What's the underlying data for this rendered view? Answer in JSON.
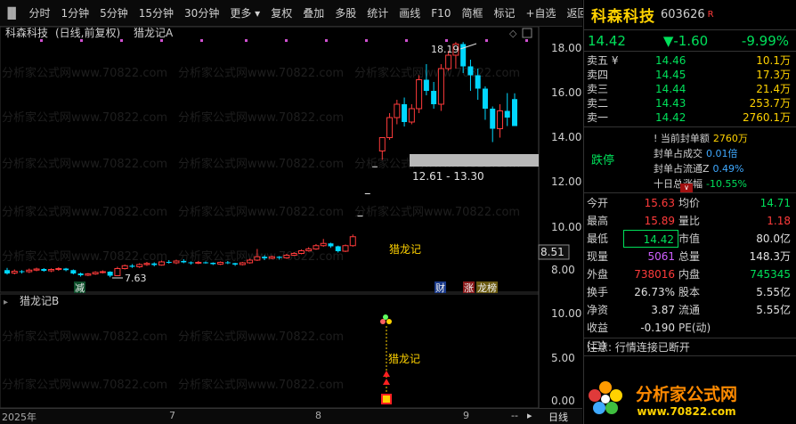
{
  "toolbar": {
    "items": [
      "分时",
      "1分钟",
      "5分钟",
      "15分钟",
      "30分钟",
      "更多",
      "复权",
      "叠加",
      "多股",
      "统计",
      "画线",
      "F10",
      "简框",
      "标记",
      "+自选",
      "返回"
    ]
  },
  "chart": {
    "title_stock": "科森科技",
    "title_mode": "(日线,前复权)",
    "indicator_a": "猎龙记A",
    "indicator_b": "猎龙记B",
    "high_label": "18.19",
    "low_label": "7.63",
    "range_label": "12.61 - 13.30",
    "signal_label": "猎龙记",
    "signal_label_b": "猎龙记",
    "current_price_tag": "8.51",
    "price_axis": [
      "18.00",
      "16.00",
      "14.00",
      "12.00",
      "10.00",
      "8.00"
    ],
    "indicator_axis": [
      "10.00",
      "5.00",
      "0.00"
    ],
    "markers": {
      "jian": "减",
      "cai": "财",
      "zhang": "涨",
      "long": "龙榜"
    },
    "watermark": "分析家公式网www.70822.com",
    "x_labels": [
      "2025年",
      "7",
      "8",
      "9"
    ],
    "period": "日线",
    "scroll_btn": "--"
  },
  "chart_data": {
    "type": "candlestick",
    "title": "科森科技 (日线,前复权)",
    "ylim": [
      6.5,
      19.3
    ],
    "candles": [
      {
        "o": 7.95,
        "c": 7.8,
        "h": 8.05,
        "l": 7.75
      },
      {
        "o": 7.82,
        "c": 7.9,
        "h": 7.98,
        "l": 7.76
      },
      {
        "o": 7.9,
        "c": 7.88,
        "h": 7.95,
        "l": 7.8
      },
      {
        "o": 7.88,
        "c": 7.95,
        "h": 8.02,
        "l": 7.82
      },
      {
        "o": 7.95,
        "c": 8.0,
        "h": 8.06,
        "l": 7.9
      },
      {
        "o": 8.0,
        "c": 7.92,
        "h": 8.04,
        "l": 7.88
      },
      {
        "o": 7.92,
        "c": 7.98,
        "h": 8.03,
        "l": 7.86
      },
      {
        "o": 7.98,
        "c": 8.02,
        "h": 8.08,
        "l": 7.92
      },
      {
        "o": 8.02,
        "c": 7.95,
        "h": 8.05,
        "l": 7.9
      },
      {
        "o": 7.95,
        "c": 7.8,
        "h": 7.98,
        "l": 7.76
      },
      {
        "o": 7.8,
        "c": 7.72,
        "h": 7.84,
        "l": 7.66
      },
      {
        "o": 7.72,
        "c": 7.78,
        "h": 7.82,
        "l": 7.68
      },
      {
        "o": 7.78,
        "c": 7.85,
        "h": 7.9,
        "l": 7.74
      },
      {
        "o": 7.85,
        "c": 7.88,
        "h": 7.94,
        "l": 7.8
      },
      {
        "o": 7.88,
        "c": 7.7,
        "h": 7.9,
        "l": 7.63
      },
      {
        "o": 7.7,
        "c": 8.02,
        "h": 8.1,
        "l": 7.68
      },
      {
        "o": 8.02,
        "c": 8.15,
        "h": 8.2,
        "l": 7.98
      },
      {
        "o": 8.15,
        "c": 8.1,
        "h": 8.22,
        "l": 8.05
      },
      {
        "o": 8.1,
        "c": 8.2,
        "h": 8.26,
        "l": 8.05
      },
      {
        "o": 8.2,
        "c": 8.25,
        "h": 8.32,
        "l": 8.14
      },
      {
        "o": 8.25,
        "c": 8.18,
        "h": 8.3,
        "l": 8.12
      },
      {
        "o": 8.18,
        "c": 8.32,
        "h": 8.38,
        "l": 8.15
      },
      {
        "o": 8.32,
        "c": 8.28,
        "h": 8.4,
        "l": 8.24
      },
      {
        "o": 8.28,
        "c": 8.36,
        "h": 8.42,
        "l": 8.22
      },
      {
        "o": 8.36,
        "c": 8.3,
        "h": 8.44,
        "l": 8.26
      },
      {
        "o": 8.3,
        "c": 8.26,
        "h": 8.34,
        "l": 8.2
      },
      {
        "o": 8.26,
        "c": 8.3,
        "h": 8.36,
        "l": 8.22
      },
      {
        "o": 8.3,
        "c": 8.28,
        "h": 8.34,
        "l": 8.24
      },
      {
        "o": 8.28,
        "c": 8.22,
        "h": 8.3,
        "l": 8.18
      },
      {
        "o": 8.22,
        "c": 8.3,
        "h": 8.34,
        "l": 8.18
      },
      {
        "o": 8.3,
        "c": 8.26,
        "h": 8.36,
        "l": 8.22
      },
      {
        "o": 8.26,
        "c": 8.2,
        "h": 8.28,
        "l": 8.14
      },
      {
        "o": 8.2,
        "c": 8.28,
        "h": 8.32,
        "l": 8.16
      },
      {
        "o": 8.28,
        "c": 8.4,
        "h": 8.46,
        "l": 8.24
      },
      {
        "o": 8.4,
        "c": 8.55,
        "h": 8.9,
        "l": 8.36
      },
      {
        "o": 8.55,
        "c": 8.48,
        "h": 8.62,
        "l": 8.4
      },
      {
        "o": 8.48,
        "c": 8.55,
        "h": 8.6,
        "l": 8.44
      },
      {
        "o": 8.55,
        "c": 8.5,
        "h": 8.58,
        "l": 8.42
      },
      {
        "o": 8.5,
        "c": 8.62,
        "h": 8.68,
        "l": 8.46
      },
      {
        "o": 8.62,
        "c": 8.7,
        "h": 8.76,
        "l": 8.58
      },
      {
        "o": 8.7,
        "c": 8.82,
        "h": 8.88,
        "l": 8.66
      },
      {
        "o": 8.82,
        "c": 8.9,
        "h": 8.98,
        "l": 8.78
      },
      {
        "o": 8.9,
        "c": 9.05,
        "h": 9.12,
        "l": 8.86
      },
      {
        "o": 9.05,
        "c": 9.15,
        "h": 9.35,
        "l": 9.0
      },
      {
        "o": 9.15,
        "c": 9.02,
        "h": 9.18,
        "l": 8.95
      },
      {
        "o": 9.02,
        "c": 8.8,
        "h": 9.05,
        "l": 8.74
      },
      {
        "o": 8.8,
        "c": 9.05,
        "h": 9.1,
        "l": 8.76
      },
      {
        "o": 9.05,
        "c": 9.45,
        "h": 9.55,
        "l": 9.0
      },
      {
        "o": 10.4,
        "c": 10.4,
        "h": 10.4,
        "l": 10.4
      },
      {
        "o": 11.4,
        "c": 11.4,
        "h": 11.4,
        "l": 11.4
      },
      {
        "o": 12.61,
        "c": 12.61,
        "h": 12.61,
        "l": 12.61
      },
      {
        "o": 13.3,
        "c": 13.9,
        "h": 13.9,
        "l": 12.9
      },
      {
        "o": 13.9,
        "c": 14.8,
        "h": 15.0,
        "l": 13.8
      },
      {
        "o": 14.8,
        "c": 15.4,
        "h": 15.6,
        "l": 14.5
      },
      {
        "o": 15.4,
        "c": 14.6,
        "h": 15.7,
        "l": 14.4
      },
      {
        "o": 14.6,
        "c": 15.2,
        "h": 15.4,
        "l": 14.5
      },
      {
        "o": 15.2,
        "c": 16.5,
        "h": 16.7,
        "l": 15.0
      },
      {
        "o": 16.5,
        "c": 16.0,
        "h": 17.2,
        "l": 15.8
      },
      {
        "o": 16.0,
        "c": 15.4,
        "h": 16.4,
        "l": 15.2
      },
      {
        "o": 15.4,
        "c": 17.0,
        "h": 17.2,
        "l": 15.1
      },
      {
        "o": 17.0,
        "c": 17.6,
        "h": 17.8,
        "l": 16.9
      },
      {
        "o": 17.6,
        "c": 18.1,
        "h": 18.19,
        "l": 17.0
      },
      {
        "o": 18.1,
        "c": 17.1,
        "h": 18.19,
        "l": 16.8
      },
      {
        "o": 17.1,
        "c": 16.7,
        "h": 17.4,
        "l": 16.0
      },
      {
        "o": 16.7,
        "c": 16.1,
        "h": 17.0,
        "l": 15.6
      },
      {
        "o": 16.1,
        "c": 15.2,
        "h": 16.2,
        "l": 14.7
      },
      {
        "o": 15.2,
        "c": 14.3,
        "h": 15.3,
        "l": 13.7
      },
      {
        "o": 14.3,
        "c": 15.1,
        "h": 15.4,
        "l": 13.9
      },
      {
        "o": 15.1,
        "c": 14.8,
        "h": 15.9,
        "l": 14.42
      },
      {
        "o": 15.63,
        "c": 14.42,
        "h": 15.89,
        "l": 14.42
      }
    ]
  },
  "quote": {
    "name": "科森科技",
    "code": "603626",
    "badge": "R",
    "price": "14.42",
    "change": "▼-1.60",
    "change_pct": "-9.99%"
  },
  "orderbook": [
    {
      "label": "卖五 ¥",
      "price": "14.46",
      "vol": "10.1万"
    },
    {
      "label": "卖四",
      "price": "14.45",
      "vol": "17.3万"
    },
    {
      "label": "卖三",
      "price": "14.44",
      "vol": "21.4万"
    },
    {
      "label": "卖二",
      "price": "14.43",
      "vol": "253.7万"
    },
    {
      "label": "卖一",
      "price": "14.42",
      "vol": "2760.1万"
    }
  ],
  "limit": {
    "status": "跌停",
    "r1_label": "! 当前封单额",
    "r1_value": "2760万",
    "r2_label": "封单占成交",
    "r2_value": "0.01倍",
    "r3_label": "封单占流通Z",
    "r3_value": "0.49%",
    "r4_label": "十日总涨幅",
    "r4_value": "-10.55%",
    "collapse": "∨"
  },
  "stats": [
    {
      "l": "今开",
      "v": "15.63",
      "vc": "red",
      "l2": "均价",
      "v2": "14.71",
      "v2c": "green"
    },
    {
      "l": "最高",
      "v": "15.89",
      "vc": "red",
      "l2": "量比",
      "v2": "1.18",
      "v2c": "red"
    },
    {
      "l": "最低",
      "v": "14.42",
      "vc": "green",
      "l2": "市值",
      "v2": "80.0亿",
      "v2c": "white",
      "boxed": true
    },
    {
      "l": "现量",
      "v": "5061",
      "vc": "magenta",
      "l2": "总量",
      "v2": "148.3万",
      "v2c": "white"
    },
    {
      "l": "外盘",
      "v": "738016",
      "vc": "red",
      "l2": "内盘",
      "v2": "745345",
      "v2c": "green"
    },
    {
      "l": "换手",
      "v": "26.73%",
      "vc": "white",
      "l2": "股本",
      "v2": "5.55亿",
      "v2c": "white"
    },
    {
      "l": "净资",
      "v": "3.87",
      "vc": "white",
      "l2": "流通",
      "v2": "5.55亿",
      "v2c": "white"
    },
    {
      "l": "收益(二)",
      "v": "-0.190",
      "vc": "white",
      "l2": "PE(动)",
      "v2": "",
      "v2c": "white"
    }
  ],
  "notice": "注意: 行情连接已断开",
  "logo": {
    "t1": "分析家公式网",
    "t2": "www.70822.com"
  },
  "colors": {
    "up": "#ff3b3b",
    "down": "#00d7ff",
    "green": "#00e05a",
    "gold": "#ffd200"
  }
}
